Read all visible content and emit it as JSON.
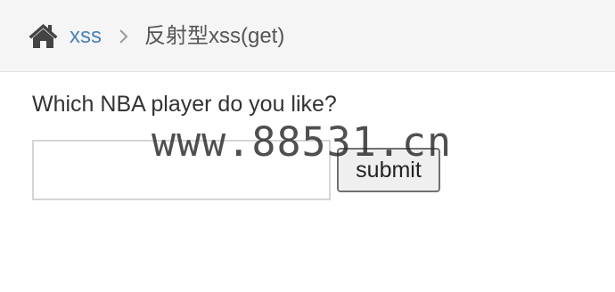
{
  "breadcrumb": {
    "home_icon": "home-icon",
    "separator_icon": "chevron-right-icon",
    "link_label": "xss",
    "current_label": "反射型xss(get)"
  },
  "form": {
    "question": "Which NBA player do you like?",
    "input_value": "",
    "submit_label": "submit"
  },
  "watermark": {
    "text": "www.88531.cn"
  },
  "colors": {
    "link": "#4a82b8",
    "breadcrumb_bg": "#f5f5f5",
    "text": "#333333"
  }
}
